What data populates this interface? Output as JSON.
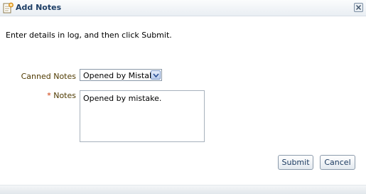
{
  "dialog": {
    "title": "Add Notes",
    "instruction": "Enter details in log, and then click Submit."
  },
  "form": {
    "canned_label": "Canned Notes",
    "canned_value": "Opened by Mistake",
    "notes_required_marker": "*",
    "notes_label": "Notes",
    "notes_value": "Opened by mistake."
  },
  "actions": {
    "submit_label": "Submit",
    "cancel_label": "Cancel"
  },
  "icons": {
    "title": "add-note-icon",
    "close": "close-icon",
    "dropdown": "chevron-down-icon"
  },
  "colors": {
    "title_text": "#1d3e66",
    "label_text": "#4f3a00",
    "required_marker": "#cc3300"
  }
}
